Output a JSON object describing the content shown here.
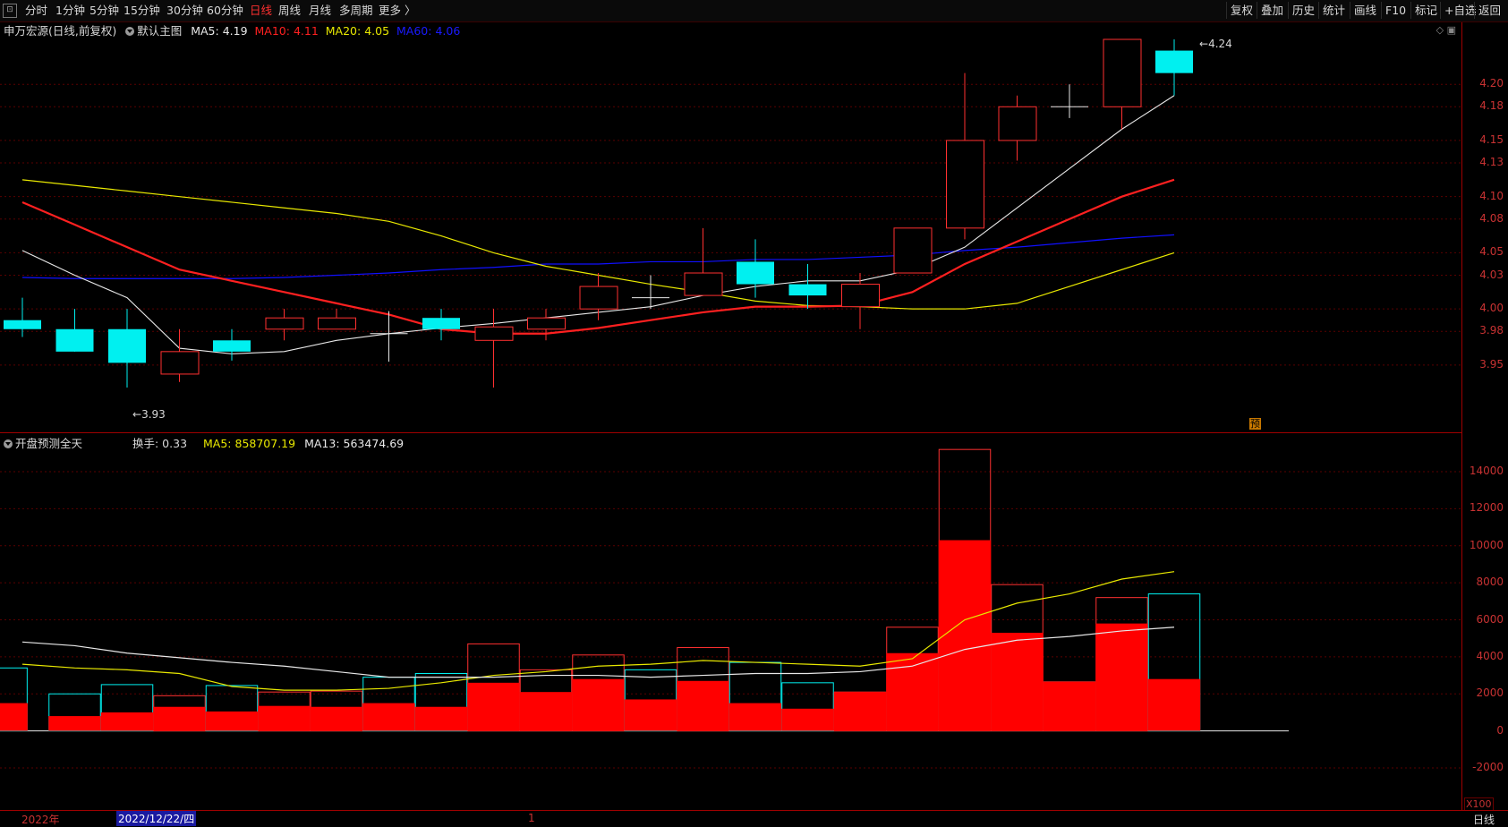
{
  "toolbar": {
    "menu_icon": "window-menu-icon",
    "periods": [
      "分时",
      "1分钟",
      "5分钟",
      "15分钟",
      "30分钟",
      "60分钟",
      "日线",
      "周线",
      "月线",
      "多周期",
      "更多 〉"
    ],
    "active_period": "日线",
    "right_buttons": [
      "复权",
      "叠加",
      "历史",
      "统计",
      "画线",
      "F10",
      "标记",
      "+自选",
      "返回"
    ]
  },
  "main": {
    "stock_title": "申万宏源(日线,前复权)",
    "template_label": "默认主图",
    "ma5": "MA5: 4.19",
    "ma10": "MA10: 4.11",
    "ma20": "MA20: 4.05",
    "ma60": "MA60: 4.06",
    "high_mark": "4.24",
    "low_mark": "3.93",
    "forecast_tag": "预",
    "price_axis": [
      "4.20",
      "4.18",
      "4.15",
      "4.13",
      "4.10",
      "4.08",
      "4.05",
      "4.03",
      "4.00",
      "3.98",
      "3.95"
    ]
  },
  "sub": {
    "indicator_name": "开盘预测全天",
    "turnover": "换手: 0.33",
    "ma5": "MA5: 858707.19",
    "ma13": "MA13: 563474.69",
    "volume_axis": [
      "14000",
      "12000",
      "10000",
      "8000",
      "6000",
      "4000",
      "2000",
      "0",
      "-2000"
    ],
    "multiplier": "X100"
  },
  "bottom": {
    "year": "2022年",
    "cursor_date": "2022/12/22/四",
    "month_mark": "1",
    "period_label": "日线"
  },
  "colors": {
    "up": "#ff3030",
    "down": "#00f0f0",
    "ma5": "#e8e8e8",
    "ma10": "#ff2020",
    "ma20": "#e8e800",
    "ma60": "#1010ff",
    "axis": "#c83232"
  },
  "candles": [
    {
      "o": 3.99,
      "h": 4.01,
      "c": 3.982,
      "l": 3.975
    },
    {
      "o": 3.982,
      "h": 4.0,
      "c": 3.962,
      "l": 3.962
    },
    {
      "o": 3.982,
      "h": 4.0,
      "c": 3.952,
      "l": 3.93
    },
    {
      "o": 3.942,
      "h": 3.982,
      "c": 3.962,
      "l": 3.935
    },
    {
      "o": 3.972,
      "h": 3.982,
      "c": 3.962,
      "l": 3.954
    },
    {
      "o": 3.982,
      "h": 4.0,
      "c": 3.992,
      "l": 3.972
    },
    {
      "o": 3.982,
      "h": 4.0,
      "c": 3.992,
      "l": 3.982
    },
    {
      "o": 3.978,
      "h": 3.998,
      "c": 3.978,
      "l": 3.953
    },
    {
      "o": 3.992,
      "h": 4.0,
      "c": 3.982,
      "l": 3.972
    },
    {
      "o": 3.972,
      "h": 4.0,
      "c": 3.984,
      "l": 3.93
    },
    {
      "o": 3.982,
      "h": 4.0,
      "c": 3.992,
      "l": 3.972
    },
    {
      "o": 4.0,
      "h": 4.032,
      "c": 4.02,
      "l": 3.99
    },
    {
      "o": 4.01,
      "h": 4.03,
      "c": 4.01,
      "l": 4.0
    },
    {
      "o": 4.012,
      "h": 4.072,
      "c": 4.032,
      "l": 4.012
    },
    {
      "o": 4.042,
      "h": 4.062,
      "c": 4.022,
      "l": 4.01
    },
    {
      "o": 4.022,
      "h": 4.04,
      "c": 4.012,
      "l": 4.0
    },
    {
      "o": 4.002,
      "h": 4.032,
      "c": 4.022,
      "l": 3.982
    },
    {
      "o": 4.032,
      "h": 4.072,
      "c": 4.072,
      "l": 4.032
    },
    {
      "o": 4.072,
      "h": 4.21,
      "c": 4.15,
      "l": 4.062
    },
    {
      "o": 4.15,
      "h": 4.19,
      "c": 4.18,
      "l": 4.132
    },
    {
      "o": 4.18,
      "h": 4.2,
      "c": 4.18,
      "l": 4.17
    },
    {
      "o": 4.18,
      "h": 4.24,
      "c": 4.24,
      "l": 4.16
    },
    {
      "o": 4.23,
      "h": 4.24,
      "c": 4.21,
      "l": 4.19
    }
  ],
  "ma_lines": {
    "ma5": [
      4.052,
      4.03,
      4.01,
      3.965,
      3.96,
      3.962,
      3.972,
      3.978,
      3.983,
      3.987,
      3.992,
      3.997,
      4.002,
      4.012,
      4.02,
      4.025,
      4.025,
      4.035,
      4.055,
      4.09,
      4.125,
      4.16,
      4.19
    ],
    "ma10": [
      4.095,
      4.075,
      4.055,
      4.035,
      4.025,
      4.015,
      4.005,
      3.995,
      3.982,
      3.978,
      3.978,
      3.983,
      3.99,
      3.997,
      4.002,
      4.002,
      4.003,
      4.015,
      4.04,
      4.06,
      4.08,
      4.1,
      4.115
    ],
    "ma20": [
      4.115,
      4.11,
      4.105,
      4.1,
      4.095,
      4.09,
      4.085,
      4.078,
      4.065,
      4.05,
      4.038,
      4.03,
      4.022,
      4.015,
      4.007,
      4.003,
      4.002,
      4.0,
      4.0,
      4.005,
      4.02,
      4.035,
      4.05
    ],
    "ma60": [
      4.028,
      4.027,
      4.027,
      4.027,
      4.027,
      4.028,
      4.03,
      4.032,
      4.035,
      4.037,
      4.04,
      4.04,
      4.042,
      4.042,
      4.044,
      4.044,
      4.046,
      4.048,
      4.052,
      4.055,
      4.059,
      4.063,
      4.066
    ]
  },
  "volume_bars": [
    {
      "total": 3400,
      "fill": 1500,
      "up": false
    },
    {
      "total": 2000,
      "fill": 800,
      "up": false
    },
    {
      "total": 2500,
      "fill": 1000,
      "up": false
    },
    {
      "total": 1900,
      "fill": 1300,
      "up": true
    },
    {
      "total": 2450,
      "fill": 1050,
      "up": false
    },
    {
      "total": 2100,
      "fill": 1350,
      "up": true
    },
    {
      "total": 2150,
      "fill": 1300,
      "up": true
    },
    {
      "total": 2900,
      "fill": 1500,
      "up": false
    },
    {
      "total": 3100,
      "fill": 1300,
      "up": false
    },
    {
      "total": 4700,
      "fill": 2600,
      "up": true
    },
    {
      "total": 3300,
      "fill": 2100,
      "up": true
    },
    {
      "total": 4100,
      "fill": 2800,
      "up": true
    },
    {
      "total": 3300,
      "fill": 1700,
      "up": false
    },
    {
      "total": 4500,
      "fill": 2700,
      "up": true
    },
    {
      "total": 3700,
      "fill": 1500,
      "up": false
    },
    {
      "total": 2600,
      "fill": 1200,
      "up": false
    },
    {
      "total": 2100,
      "fill": 2100,
      "up": true
    },
    {
      "total": 5600,
      "fill": 4200,
      "up": true
    },
    {
      "total": 15200,
      "fill": 10300,
      "up": true
    },
    {
      "total": 7900,
      "fill": 5300,
      "up": true
    },
    {
      "total": 2650,
      "fill": 2650,
      "up": true
    },
    {
      "total": 7200,
      "fill": 5800,
      "up": true
    },
    {
      "total": 7400,
      "fill": 2800,
      "up": false
    }
  ],
  "vol_ma": {
    "ma5": [
      3600,
      3400,
      3300,
      3100,
      2400,
      2200,
      2200,
      2300,
      2600,
      3000,
      3200,
      3500,
      3600,
      3800,
      3700,
      3600,
      3500,
      3900,
      6000,
      6900,
      7400,
      8200,
      8600
    ],
    "ma13": [
      4800,
      4600,
      4200,
      3950,
      3700,
      3500,
      3200,
      2900,
      2900,
      2900,
      3000,
      3000,
      2900,
      3000,
      3100,
      3100,
      3200,
      3500,
      4400,
      4900,
      5100,
      5400,
      5600
    ]
  }
}
